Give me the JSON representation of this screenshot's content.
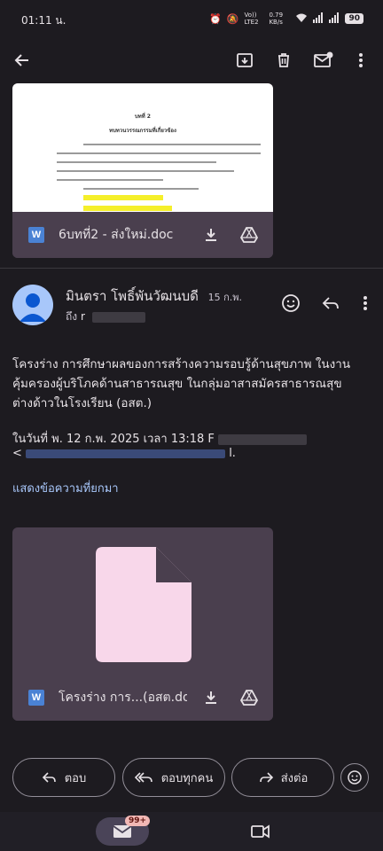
{
  "status_bar": {
    "time": "01:11 น.",
    "net_type": "Vo)) LTE2",
    "net_speed": "0.79 KB/s",
    "battery": "90"
  },
  "toolbar": {
    "icons": [
      "back-arrow-icon",
      "archive-icon",
      "delete-icon",
      "mark-unread-icon",
      "more-vert-icon"
    ]
  },
  "preview_document": {
    "heading": "บทที่ 2",
    "subheading": "ทบทวนวรรณกรรมที่เกี่ยวข้อง"
  },
  "first_attachment": {
    "file_name": "6บทที่2 - ส่งใหม่.doc",
    "file_type_icon": "W"
  },
  "message": {
    "sender_name": "มินตรา โพธิ์พันวัฒนบดี",
    "date": "15 ก.พ.",
    "to_prefix": "ถึง ",
    "body": "โครงร่าง การศึกษาผลของการสร้างความรอบรู้ด้านสุขภาพ ในงานคุ้มครองผู้บริโภคด้านสาธารณสุข ในกลุ่มอาสาสมัครสาธารณสุขต่างด้าวในโรงเรียน (อสต.)",
    "quoted_header": "ในวันที่ พ. 12 ก.พ. 2025 เวลา 13:18 F",
    "quoted_line2_start": "<",
    "quoted_line2_end": "l.",
    "show_trimmed": "แสดงข้อความที่ยกมา"
  },
  "second_attachment": {
    "file_name": "โครงร่าง การ...(อสต.docx",
    "file_type_icon": "W"
  },
  "reply_actions": {
    "reply": "ตอบ",
    "reply_all": "ตอบทุกคน",
    "forward": "ส่งต่อ"
  },
  "bottom_nav": {
    "mail_badge": "99+"
  },
  "colors": {
    "background": "#1d1b20",
    "attachment_card": "#4a3f4e",
    "file_icon_fill": "#f8d7ea",
    "link": "#a8c7fa",
    "highlight": "#f5ef2a"
  }
}
